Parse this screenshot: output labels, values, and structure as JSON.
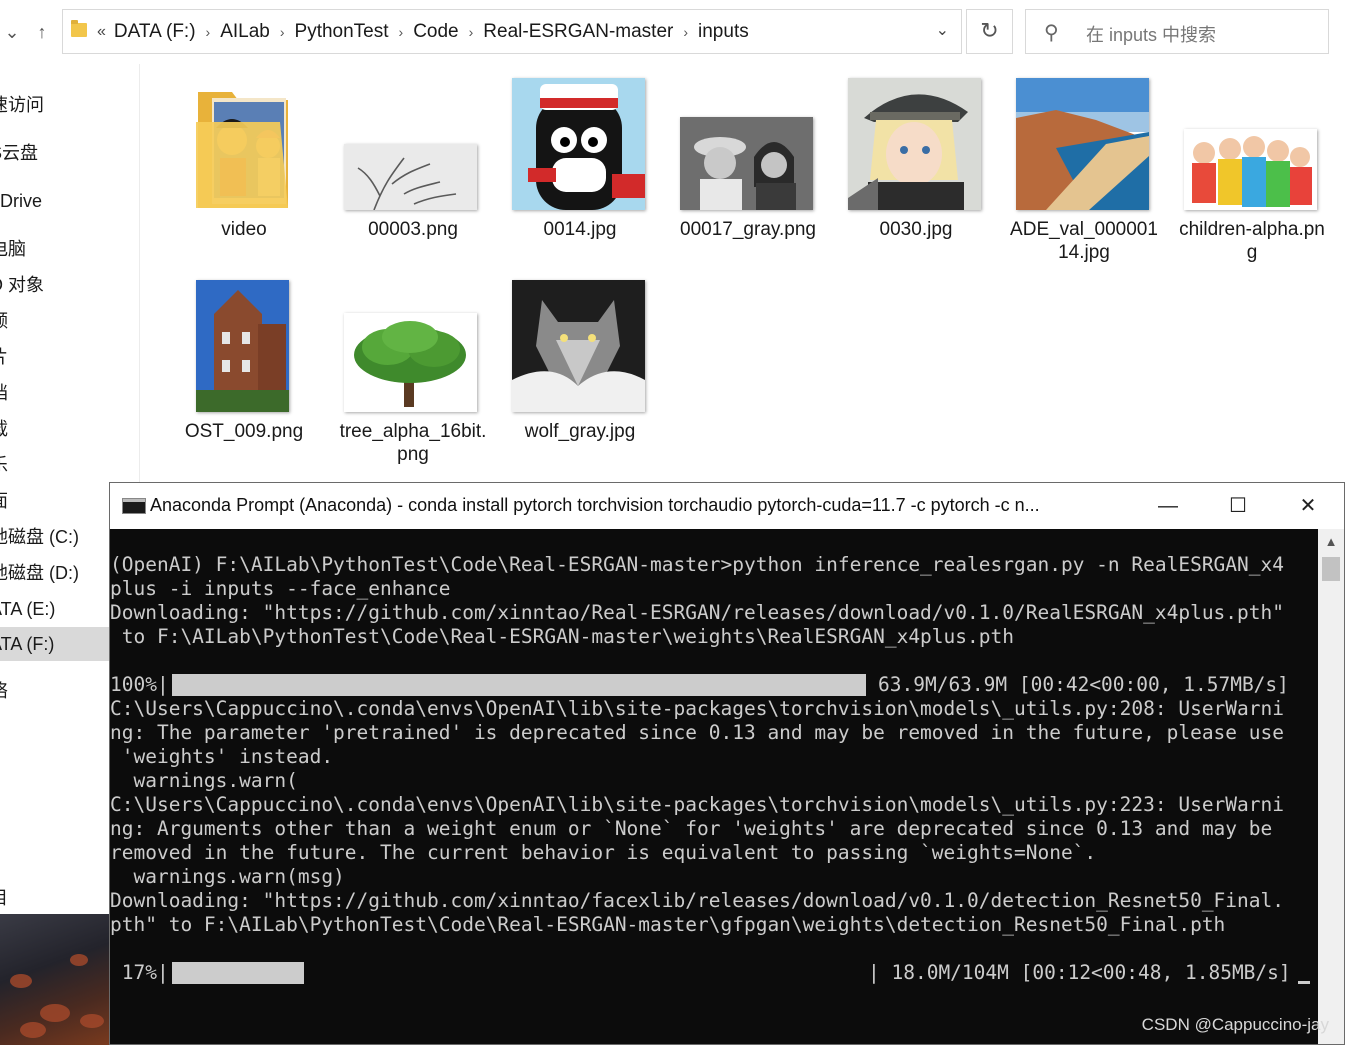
{
  "explorer": {
    "breadcrumb_lead": "«",
    "breadcrumbs": [
      "DATA (F:)",
      "AILab",
      "PythonTest",
      "Code",
      "Real-ESRGAN-master",
      "inputs"
    ],
    "search_placeholder": "在 inputs 中搜索",
    "nav_items": [
      {
        "label": "速访问"
      },
      {
        "label": "S云盘"
      },
      {
        "label": "eDrive"
      },
      {
        "label": "电脑"
      },
      {
        "label": "D 对象"
      },
      {
        "label": "频"
      },
      {
        "label": "片"
      },
      {
        "label": "档"
      },
      {
        "label": "载"
      },
      {
        "label": "乐"
      },
      {
        "label": "面"
      },
      {
        "label": "地磁盘 (C:)"
      },
      {
        "label": "地磁盘 (D:)"
      },
      {
        "label": "ATA (E:)"
      },
      {
        "label": "ATA (F:)"
      },
      {
        "label": "络"
      },
      {
        "label": "目"
      }
    ],
    "files": [
      {
        "name": "video"
      },
      {
        "name": "00003.png"
      },
      {
        "name": "0014.jpg"
      },
      {
        "name": "00017_gray.png"
      },
      {
        "name": "0030.jpg"
      },
      {
        "name": "ADE_val_00000114.jpg"
      },
      {
        "name": "children-alpha.png"
      },
      {
        "name": "OST_009.png"
      },
      {
        "name": "tree_alpha_16bit.png"
      },
      {
        "name": "wolf_gray.jpg"
      }
    ]
  },
  "console": {
    "title": "Anaconda Prompt (Anaconda) - conda  install pytorch torchvision torchaudio pytorch-cuda=11.7 -c pytorch -c n...",
    "lines": [
      "(OpenAI) F:\\AILab\\PythonTest\\Code\\Real-ESRGAN-master>python inference_realesrgan.py -n RealESRGAN_x4",
      "plus -i inputs --face_enhance",
      "Downloading: \"https://github.com/xinntao/Real-ESRGAN/releases/download/v0.1.0/RealESRGAN_x4plus.pth\"",
      " to F:\\AILab\\PythonTest\\Code\\Real-ESRGAN-master\\weights\\RealESRGAN_x4plus.pth",
      "C:\\Users\\Cappuccino\\.conda\\envs\\OpenAI\\lib\\site-packages\\torchvision\\models\\_utils.py:208: UserWarni",
      "ng: The parameter 'pretrained' is deprecated since 0.13 and may be removed in the future, please use",
      " 'weights' instead.",
      "  warnings.warn(",
      "C:\\Users\\Cappuccino\\.conda\\envs\\OpenAI\\lib\\site-packages\\torchvision\\models\\_utils.py:223: UserWarni",
      "ng: Arguments other than a weight enum or `None` for 'weights' are deprecated since 0.13 and may be",
      "removed in the future. The current behavior is equivalent to passing `weights=None`.",
      "  warnings.warn(msg)",
      "Downloading: \"https://github.com/xinntao/facexlib/releases/download/v0.1.0/detection_Resnet50_Final.",
      "pth\" to F:\\AILab\\PythonTest\\Code\\Real-ESRGAN-master\\gfpgan\\weights\\detection_Resnet50_Final.pth"
    ],
    "progress1": {
      "pct_label": "100%|",
      "stats": "63.9M/63.9M [00:42<00:00, 1.57MB/s]",
      "fraction": 1.0
    },
    "progress2": {
      "pct_label": " 17%|",
      "stats": "| 18.0M/104M [00:12<00:48, 1.85MB/s]",
      "fraction": 0.17
    }
  },
  "watermark": "CSDN @Cappuccino-jay",
  "colors": {
    "console_bg": "#0c0c0c",
    "console_text": "#cccccc",
    "selected_nav": "#d9d9d9"
  }
}
